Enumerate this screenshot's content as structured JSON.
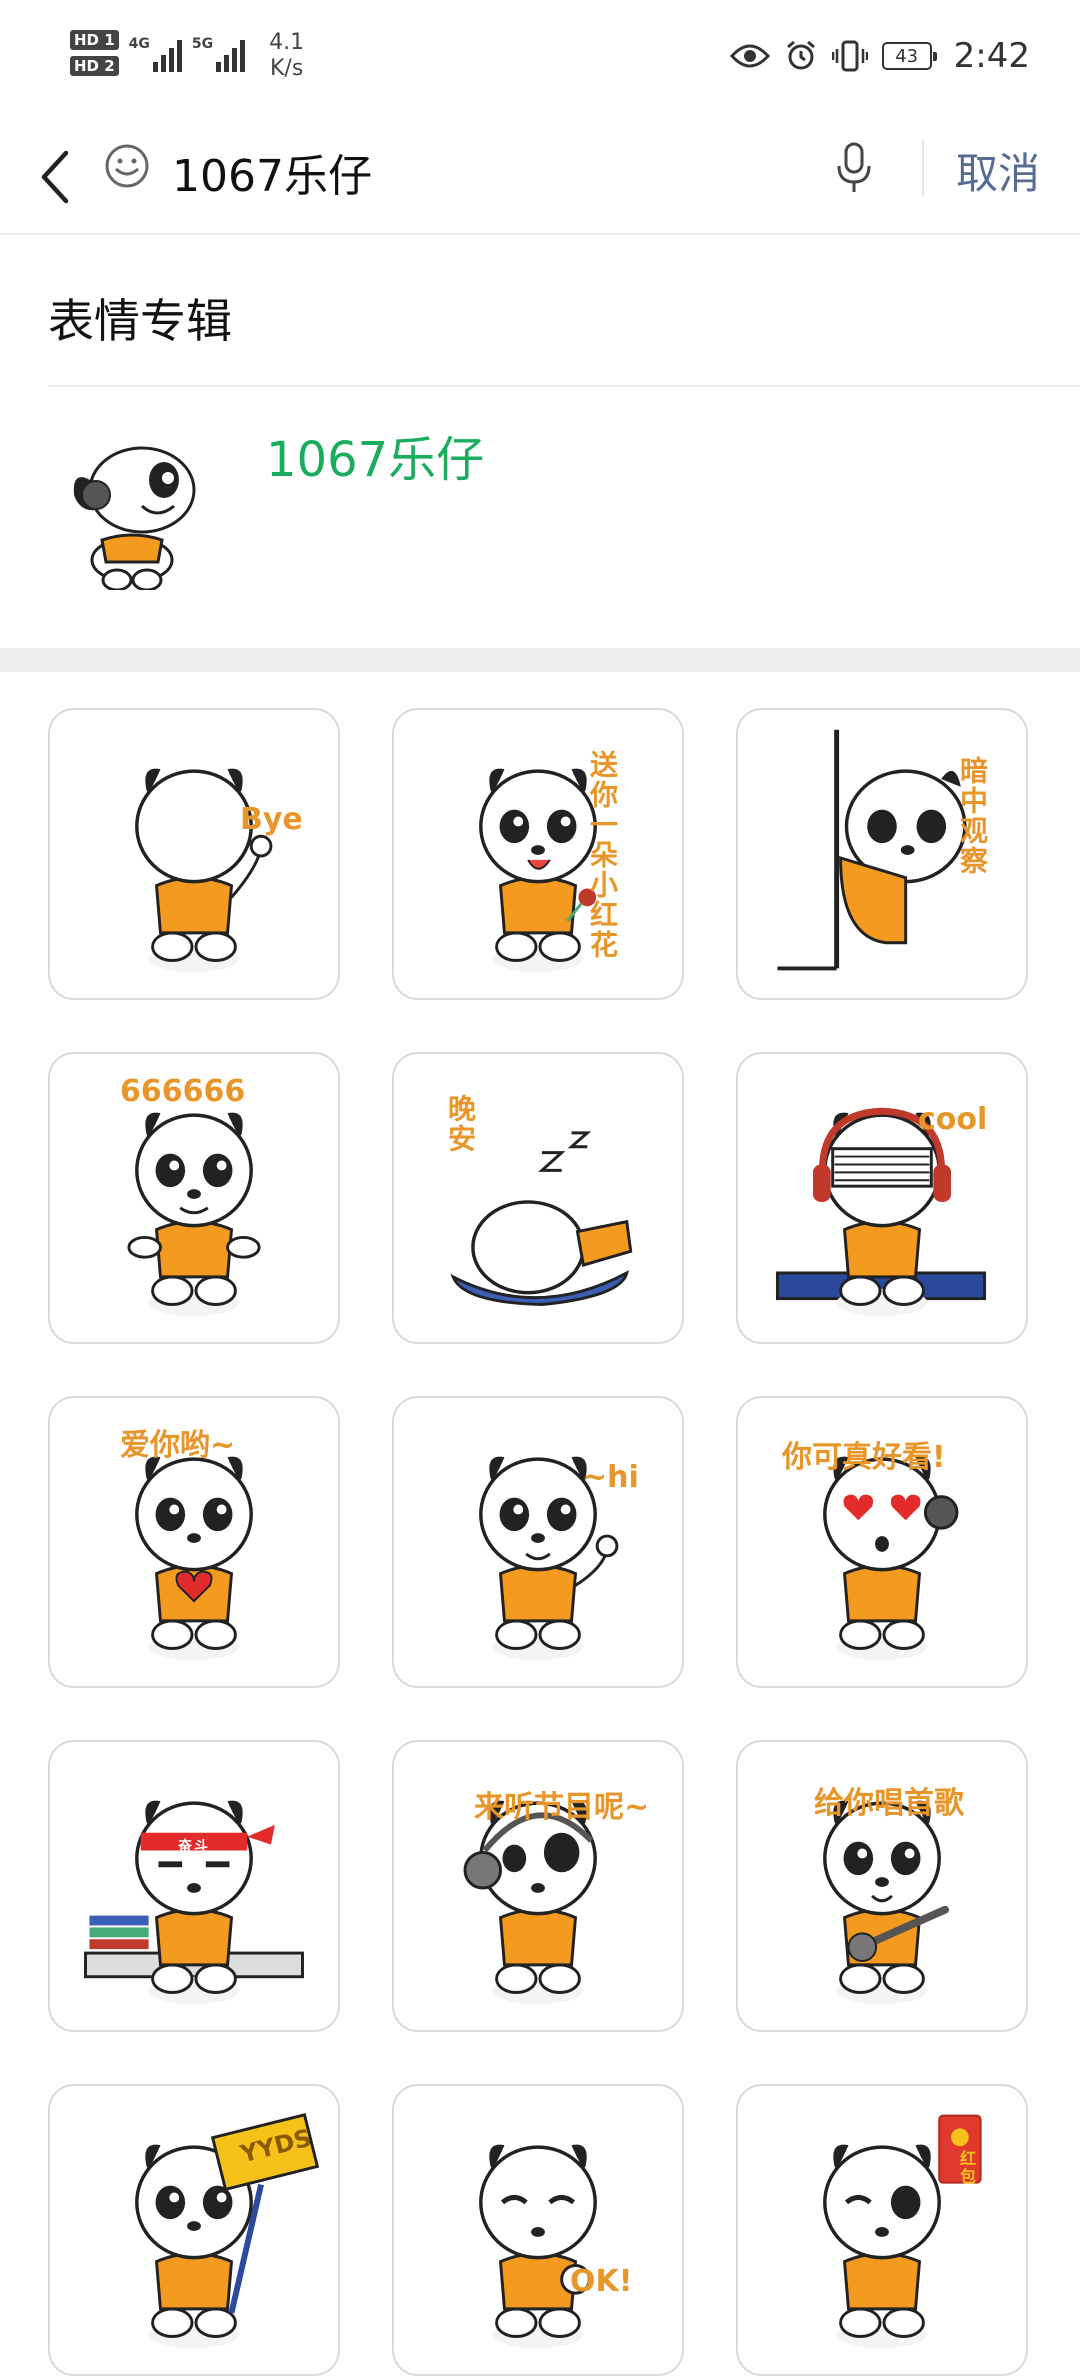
{
  "status_bar": {
    "sim1": "HD 1",
    "sim2": "HD 2",
    "net1": "4G",
    "net2": "5G",
    "speed_value": "4.1",
    "speed_unit": "K/s",
    "battery": "43",
    "time": "2:42"
  },
  "search": {
    "query": "1067乐仔",
    "cancel_label": "取消"
  },
  "album_section": {
    "title": "表情专辑",
    "album_name": "1067乐仔"
  },
  "stickers": [
    {
      "id": "s1",
      "caption": "Bye",
      "pose": "wave-back"
    },
    {
      "id": "s2",
      "caption": "送你一朵小红花",
      "pose": "flower"
    },
    {
      "id": "s3",
      "caption": "暗中观察",
      "pose": "peek"
    },
    {
      "id": "s4",
      "caption": "666666",
      "pose": "six"
    },
    {
      "id": "s5",
      "caption": "晚安",
      "pose": "sleep"
    },
    {
      "id": "s6",
      "caption": "cool",
      "pose": "dj"
    },
    {
      "id": "s7",
      "caption": "爱你哟~",
      "pose": "heart"
    },
    {
      "id": "s8",
      "caption": "~hi",
      "pose": "hi"
    },
    {
      "id": "s9",
      "caption": "你可真好看!",
      "pose": "love-eyes"
    },
    {
      "id": "s10",
      "caption": "奋斗",
      "pose": "study"
    },
    {
      "id": "s11",
      "caption": "来听节目呢~",
      "pose": "listen"
    },
    {
      "id": "s12",
      "caption": "给你唱首歌",
      "pose": "sing"
    },
    {
      "id": "s13",
      "caption": "YYDS",
      "pose": "sign"
    },
    {
      "id": "s14",
      "caption": "OK!",
      "pose": "ok"
    },
    {
      "id": "s15",
      "caption": "红包",
      "pose": "hongbao"
    }
  ],
  "colors": {
    "accent_green": "#1aad5e",
    "link_blue": "#576b95",
    "sticker_orange": "#e8962a"
  }
}
